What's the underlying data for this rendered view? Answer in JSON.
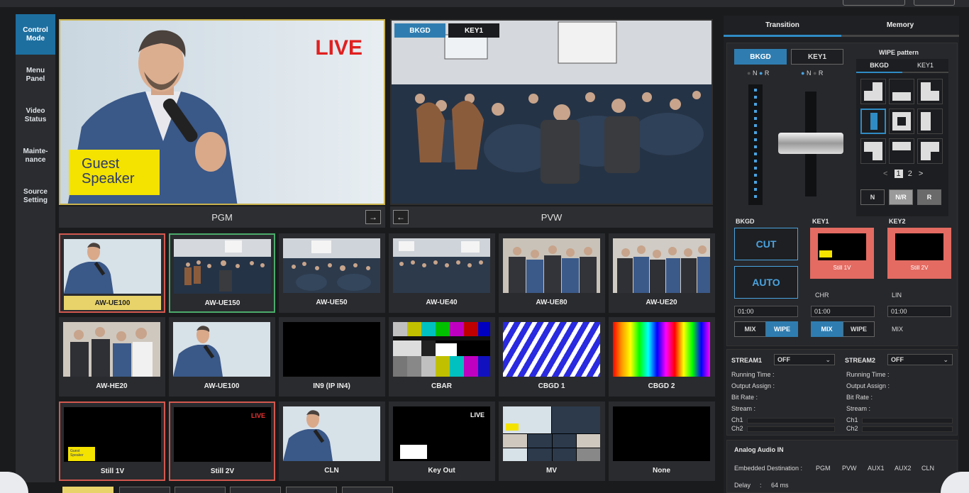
{
  "sidebar": {
    "items": [
      {
        "label": "Control\nMode",
        "active": true
      },
      {
        "label": "Menu\nPanel",
        "active": false
      },
      {
        "label": "Video\nStatus",
        "active": false
      },
      {
        "label": "Mainte-\nnance",
        "active": false
      },
      {
        "label": "Source\nSetting",
        "active": false
      }
    ]
  },
  "pgm": {
    "label": "PGM",
    "live": "LIVE",
    "caption_line1": "Guest",
    "caption_line2": "Speaker",
    "next_icon": "→"
  },
  "pvw": {
    "label": "PVW",
    "prev_icon": "←",
    "tab_bkgd": "BKGD",
    "tab_key1": "KEY1"
  },
  "sources": {
    "row1": [
      "AW-UE100",
      "AW-UE150",
      "AW-UE50",
      "AW-UE40",
      "AW-UE80",
      "AW-UE20"
    ],
    "row2": [
      "AW-HE20",
      "AW-UE100",
      "IN9 (IP IN4)",
      "CBAR",
      "CBGD 1",
      "CBGD 2"
    ],
    "row3": [
      "Still 1V",
      "Still 2V",
      "CLN",
      "Key Out",
      "MV",
      "None"
    ],
    "live": "LIVE",
    "guest_tiny": "Guest\nSpeaker"
  },
  "colors": {
    "pgm_border": "#d2584f",
    "pvw_border": "#4bab6a",
    "accent": "#2f7db0",
    "live_red": "#e02020",
    "caption_yellow": "#f4e200"
  },
  "right": {
    "tabs": [
      "Transition",
      "Memory"
    ],
    "bkgd_btn": "BKGD",
    "key1_btn": "KEY1",
    "nr_n": "N",
    "nr_r": "R",
    "wipe_title": "WIPE pattern",
    "wipe_tab_bkgd": "BKGD",
    "wipe_tab_key1": "KEY1",
    "page_prev": "<",
    "page1": "1",
    "page2": "2",
    "page_next": ">",
    "btn_n": "N",
    "btn_nr": "N/R",
    "btn_r": "R",
    "bkgd_label": "BKGD",
    "key1_label": "KEY1",
    "key2_label": "KEY2",
    "cut": "CUT",
    "auto": "AUTO",
    "still1": "Still 1V",
    "still2": "Still 2V",
    "chr": "CHR",
    "lin": "LIN",
    "time1": "01:00",
    "time2": "01:00",
    "time3": "01:00",
    "mix": "MIX",
    "wipe": "WIPE"
  },
  "stream": {
    "s1_label": "STREAM1",
    "s1_value": "OFF",
    "s2_label": "STREAM2",
    "s2_value": "OFF",
    "running": "Running Time :",
    "output": "Output Assign :",
    "bitrate": "Bit Rate :",
    "stream": "Stream :",
    "ch1": "Ch1",
    "ch2": "Ch2"
  },
  "audio": {
    "title": "Analog Audio IN",
    "dest_label": "Embedded Destination :",
    "dests": [
      "PGM",
      "PVW",
      "AUX1",
      "AUX2",
      "CLN"
    ],
    "delay_label": "Delay",
    "delay_sep": ":",
    "delay_value": "64 ms"
  }
}
